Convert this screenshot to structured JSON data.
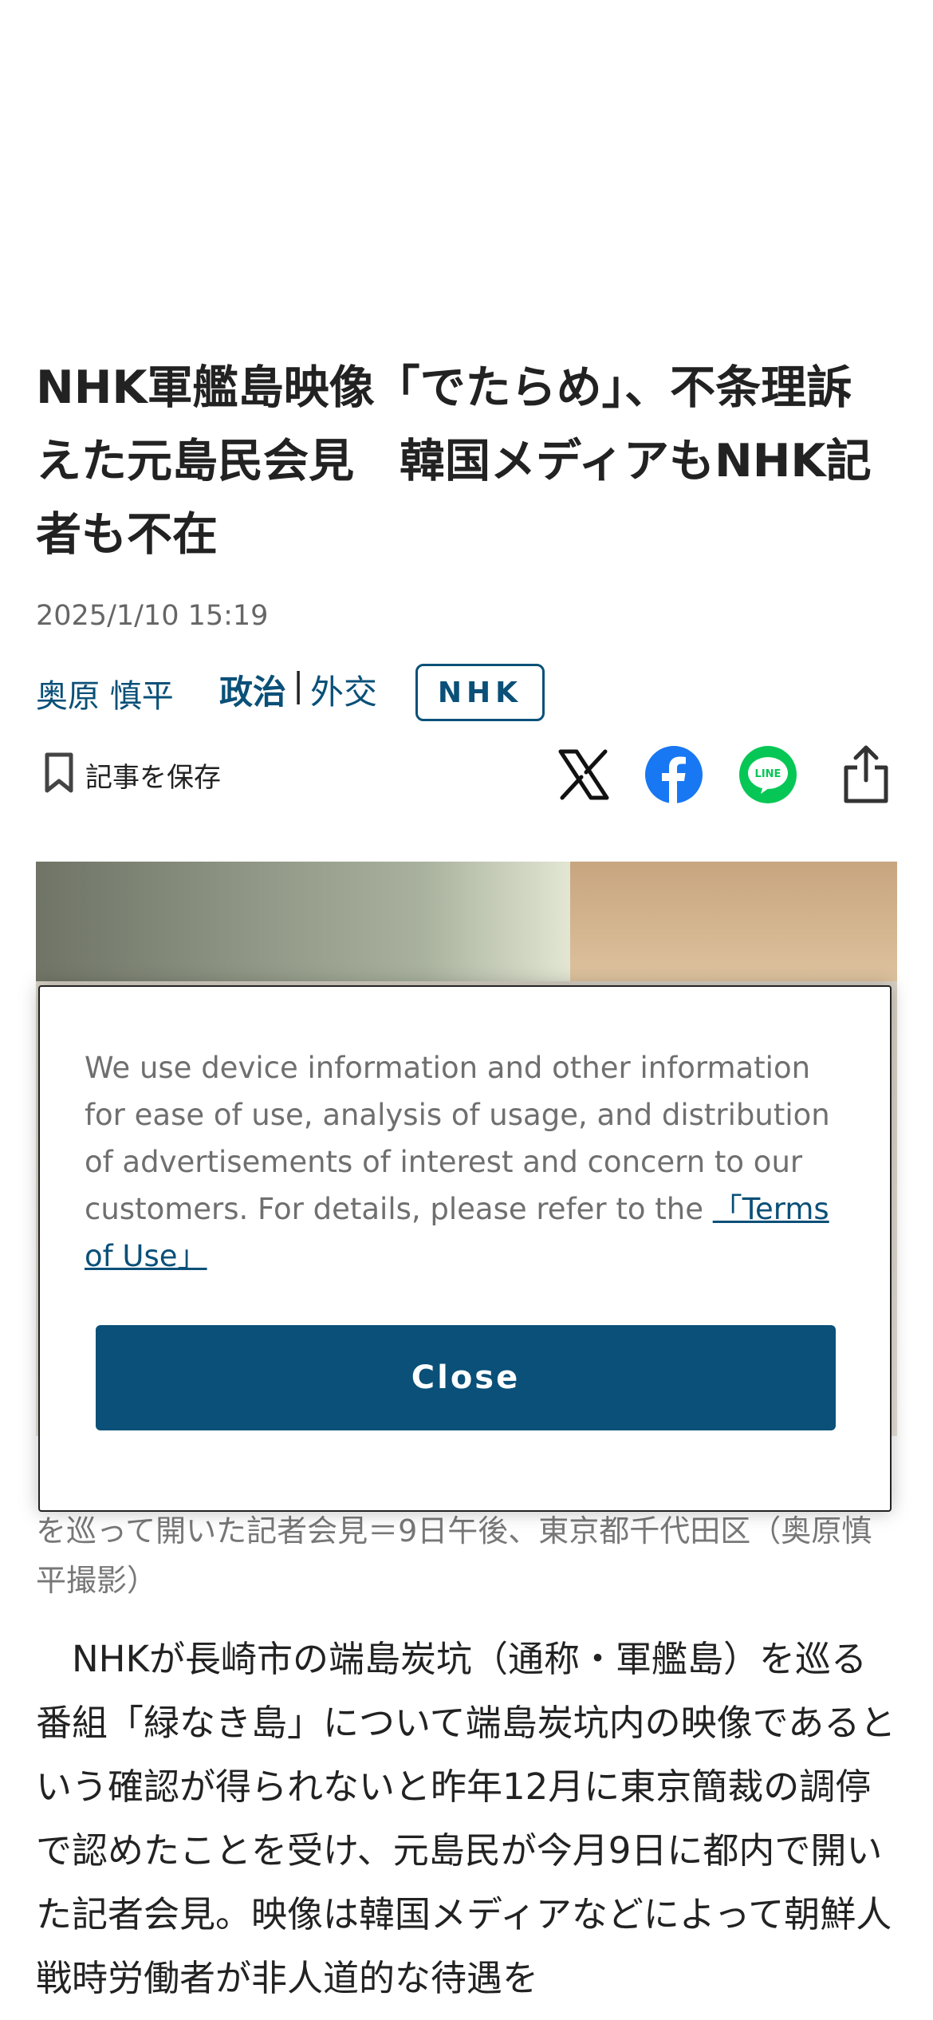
{
  "article": {
    "headline": "NHK軍艦島映像「でたらめ」、不条理訴えた元島民会見　韓国メディアもNHK記者も不在",
    "date": "2025/1/10 15:19",
    "author": "奥原 慎平",
    "category_main": "政治",
    "category_sep": "|",
    "category_sub": "外交",
    "tag": "NHK",
    "save_label": "記事を保存",
    "caption": "を巡って開いた記者会見＝9日午後、東京都千代田区（奥原慎平撮影）",
    "body": "　NHKが長崎市の端島炭坑（通称・軍艦島）を巡る番組「緑なき島」について端島炭坑内の映像であるという確認が得られないと昨年12月に東京簡裁の調停で認めたことを受け、元島民が今月9日に都内で開いた記者会見。映像は韓国メディアなどによって朝鮮人戦時労働者が非人道的な待遇を"
  },
  "share": {
    "icons": [
      "x-icon",
      "facebook-icon",
      "line-icon",
      "share-icon"
    ],
    "line_text": "LINE"
  },
  "consent": {
    "text": "We use device information and other information for ease of use, analysis of usage, and distribution of advertisements of interest and concern to our customers. For details, please refer to the ",
    "link": "「Terms of Use」",
    "close_label": "Close"
  },
  "colors": {
    "accent": "#0a5078",
    "facebook": "#1877f2",
    "line": "#06c755"
  }
}
